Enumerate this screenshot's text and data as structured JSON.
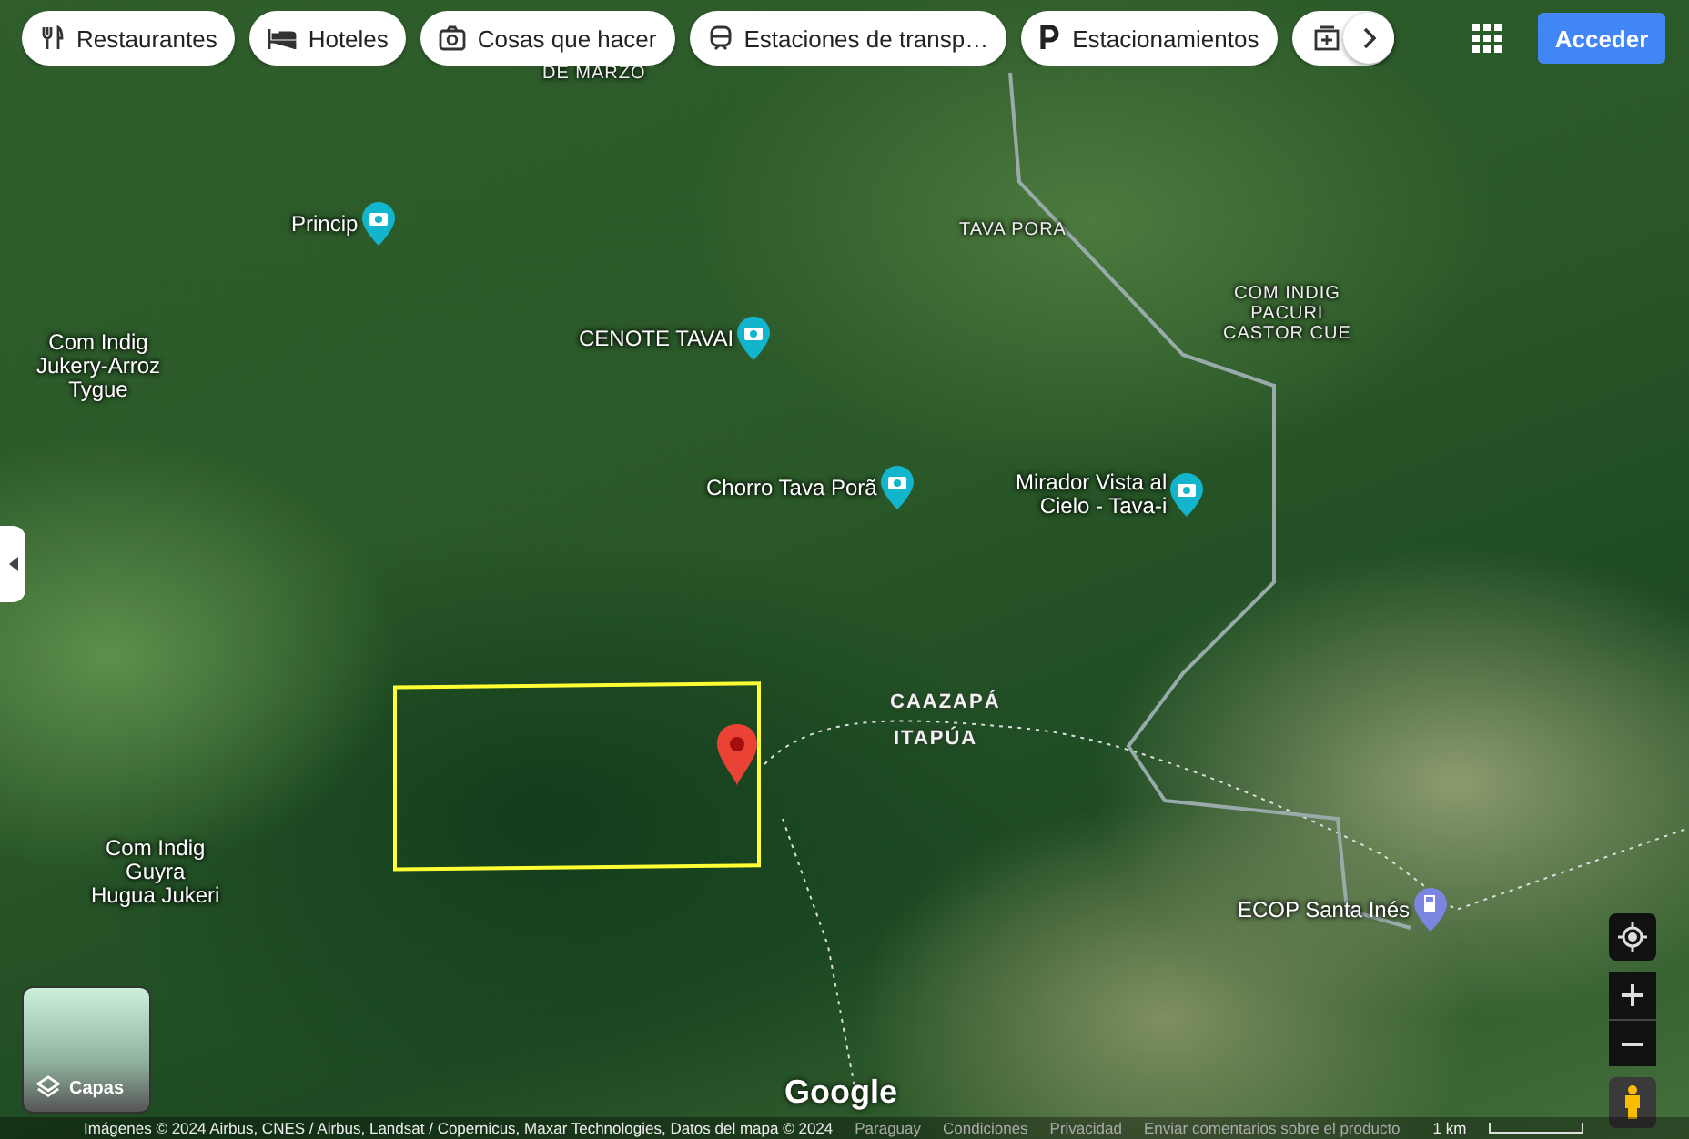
{
  "chips": [
    {
      "kind": "restaurant",
      "label": "Restaurantes"
    },
    {
      "kind": "hotel",
      "label": "Hoteles"
    },
    {
      "kind": "camera",
      "label": "Cosas que hacer"
    },
    {
      "kind": "transit",
      "label": "Estaciones de transp…"
    },
    {
      "kind": "parking",
      "label": "Estacionamientos"
    },
    {
      "kind": "pharmacy"
    }
  ],
  "account": {
    "sign_in": "Acceder"
  },
  "map_labels": [
    {
      "kind": "caps",
      "text": "DE MARZO"
    },
    {
      "kind": "camera",
      "text": "Princip"
    },
    {
      "kind": "plain",
      "text": "Com Indig\nJukery-Arroz\nTygue"
    },
    {
      "kind": "camera",
      "text": "CENOTE TAVAI"
    },
    {
      "kind": "caps",
      "text": "TAVA PORA"
    },
    {
      "kind": "caps",
      "text": "COM INDIG\nPACURI\nCASTOR CUE"
    },
    {
      "kind": "camera",
      "text": "Chorro Tava Porã"
    },
    {
      "kind": "camera",
      "text": "Mirador Vista al\nCielo - Tava-i"
    },
    {
      "kind": "region",
      "text": "CAAZAPÁ"
    },
    {
      "kind": "region",
      "text": "ITAPÚA"
    },
    {
      "kind": "plain",
      "text": "Com Indig\nGuyra\nHugua Jukeri"
    },
    {
      "kind": "fuel",
      "text": "ECOP Santa Inés"
    }
  ],
  "layers": {
    "label": "Capas"
  },
  "logo": "Google",
  "footer": {
    "attribution": "Imágenes © 2024 Airbus, CNES / Airbus, Landsat / Copernicus, Maxar Technologies, Datos del mapa © 2024",
    "links": [
      "Paraguay",
      "Condiciones",
      "Privacidad",
      "Enviar comentarios sobre el producto"
    ],
    "scale": "1 km"
  }
}
